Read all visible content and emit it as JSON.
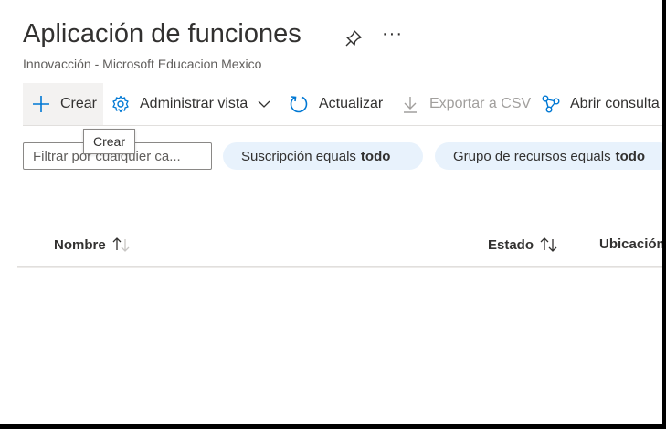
{
  "header": {
    "title": "Aplicación de funciones",
    "subtitle": "Innovacción - Microsoft Educacion Mexico",
    "more_label": "···"
  },
  "toolbar": {
    "create_label": "Crear",
    "manage_view_label": "Administrar vista",
    "refresh_label": "Actualizar",
    "export_label": "Exportar a CSV",
    "open_query_label": "Abrir consulta"
  },
  "tooltip": {
    "text": "Crear"
  },
  "filters": {
    "search_placeholder": "Filtrar por cualquier ca...",
    "subscription": {
      "label": "Suscripción equals",
      "value": "todo"
    },
    "resource_group": {
      "label": "Grupo de recursos equals",
      "value": "todo"
    }
  },
  "table": {
    "columns": [
      "Nombre",
      "Estado",
      "Ubicación"
    ]
  },
  "colors": {
    "accent": "#0078d4",
    "pill_bg": "#e8f2fc",
    "text": "#323130"
  }
}
